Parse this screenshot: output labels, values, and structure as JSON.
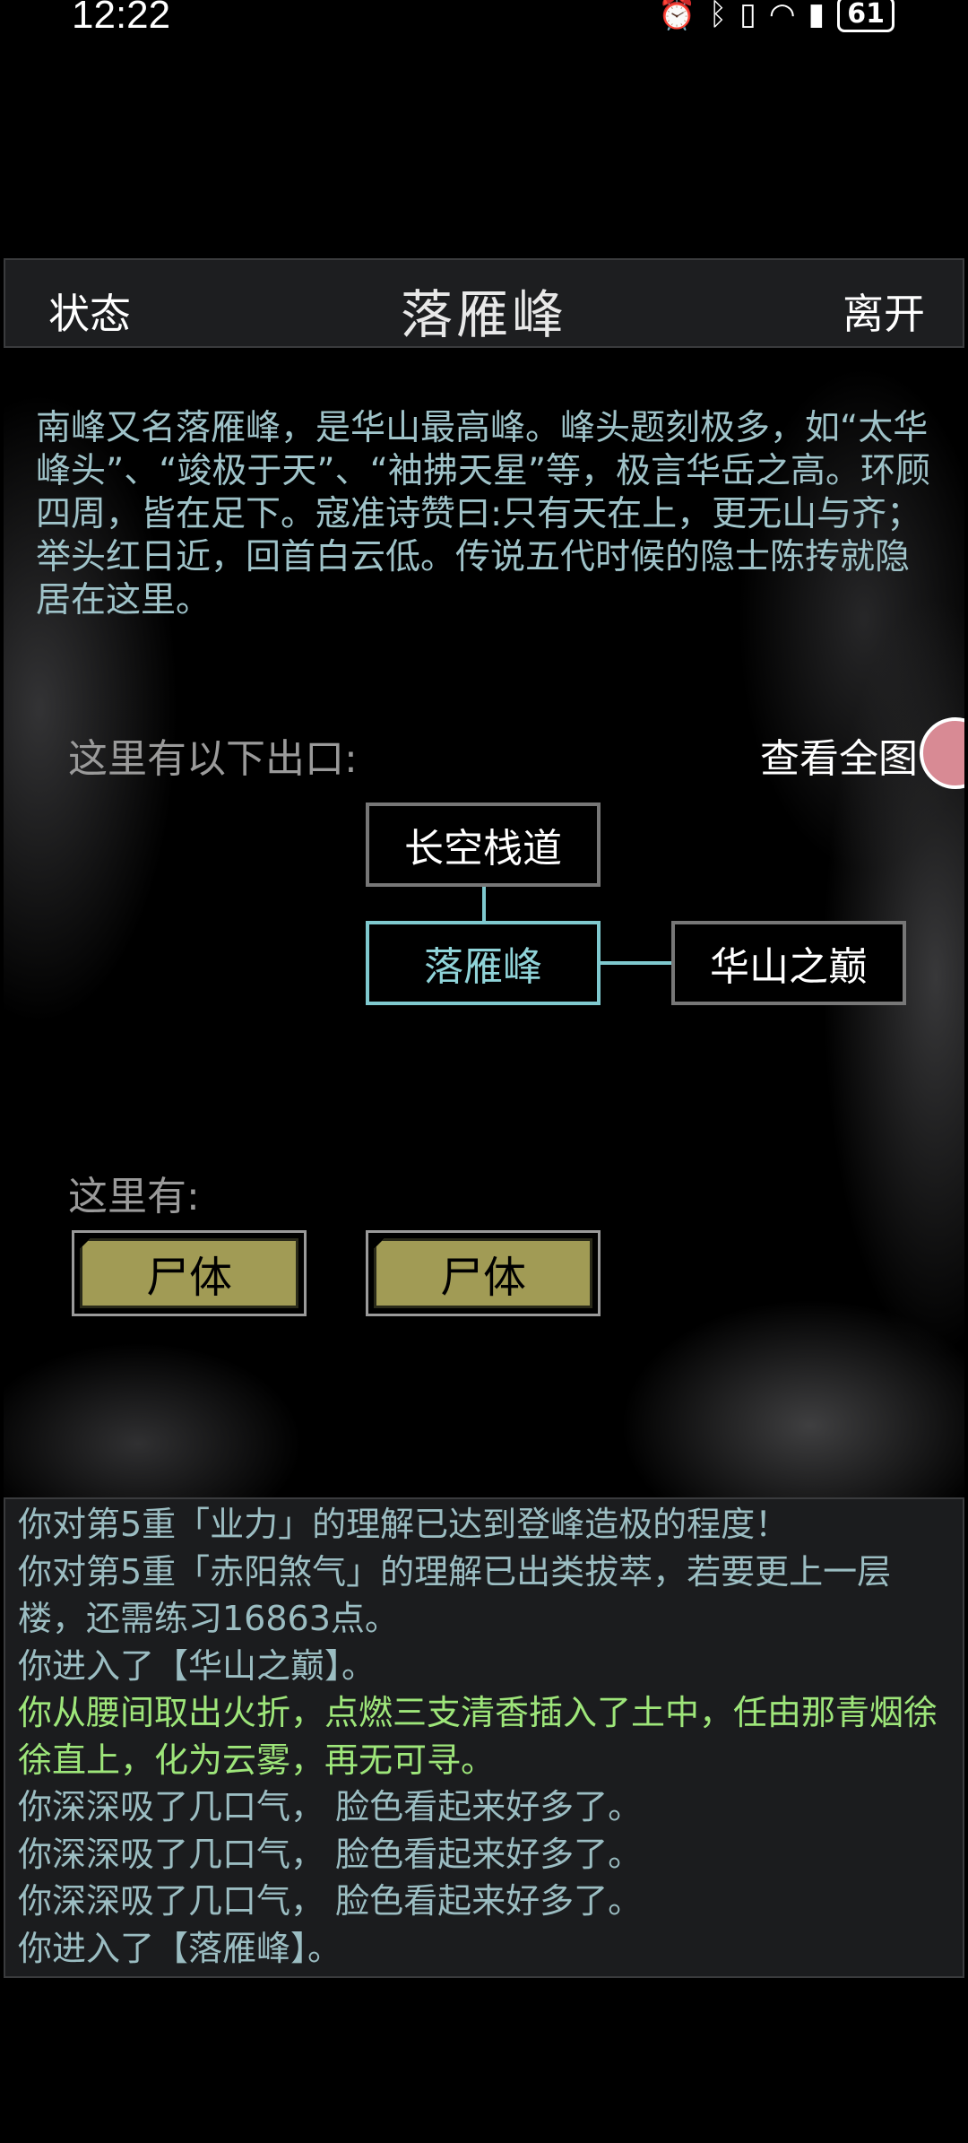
{
  "status_bar": {
    "time": "12:22",
    "battery": "61"
  },
  "header": {
    "left": "状态",
    "title": "落雁峰",
    "right": "离开"
  },
  "description": "南峰又名落雁峰，是华山最高峰。峰头题刻极多，如“太华峰头”、“竣极于天”、“袖拂天星”等，极言华岳之高。环顾四周，皆在足下。寇准诗赞曰:只有天在上，更无山与齐；举头红日近，回首白云低。传说五代时候的隐士陈抟就隐居在这里。",
  "exits": {
    "label": "这里有以下出口:",
    "full_map": "查看全图",
    "north": "长空栈道",
    "current": "落雁峰",
    "east": "华山之巅"
  },
  "here": {
    "label": "这里有:",
    "items": [
      "尸体",
      "尸体"
    ]
  },
  "log": [
    {
      "text": "你对第5重「业力」的理解已达到登峰造极的程度！",
      "color": "normal"
    },
    {
      "text": "你对第5重「赤阳煞气」的理解已出类拔萃，若要更上一层楼，还需练习16863点。",
      "color": "normal"
    },
    {
      "text": "你进入了【华山之巅】。",
      "color": "normal"
    },
    {
      "text": "你从腰间取出火折，点燃三支清香插入了土中，任由那青烟徐徐直上，化为云雾，再无可寻。",
      "color": "green"
    },
    {
      "text": "你深深吸了几口气， 脸色看起来好多了。",
      "color": "normal"
    },
    {
      "text": "你深深吸了几口气， 脸色看起来好多了。",
      "color": "normal"
    },
    {
      "text": "你深深吸了几口气， 脸色看起来好多了。",
      "color": "normal"
    },
    {
      "text": "你进入了【落雁峰】。",
      "color": "normal"
    }
  ]
}
